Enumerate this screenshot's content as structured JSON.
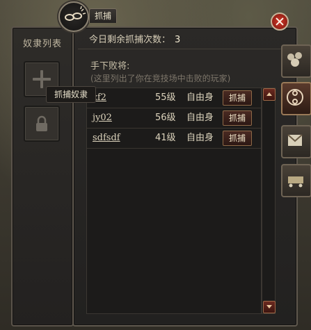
{
  "left_panel": {
    "title": "奴隶列表",
    "tooltip": "抓捕奴隶"
  },
  "tab": {
    "label": "抓捕"
  },
  "header": {
    "remaining_label": "今日剩余抓捕次数：",
    "remaining_count": "3"
  },
  "defeated": {
    "label": "手下败将:",
    "hint": "(这里列出了你在竞技场中击败的玩家)"
  },
  "rows": [
    {
      "name": "zf2",
      "level": "55级",
      "status": "自由身",
      "action": "抓捕"
    },
    {
      "name": "jy02",
      "level": "56级",
      "status": "自由身",
      "action": "抓捕"
    },
    {
      "name": "sdfsdf",
      "level": "41级",
      "status": "自由身",
      "action": "抓捕"
    }
  ],
  "colors": {
    "accent": "#8f6a48",
    "close": "#d23a2a"
  },
  "icons": [
    "plus-icon",
    "lock-icon",
    "chain-icon",
    "close-icon",
    "group-icon",
    "capture-icon",
    "mail-icon",
    "cart-icon",
    "scroll-up-icon",
    "scroll-down-icon"
  ]
}
